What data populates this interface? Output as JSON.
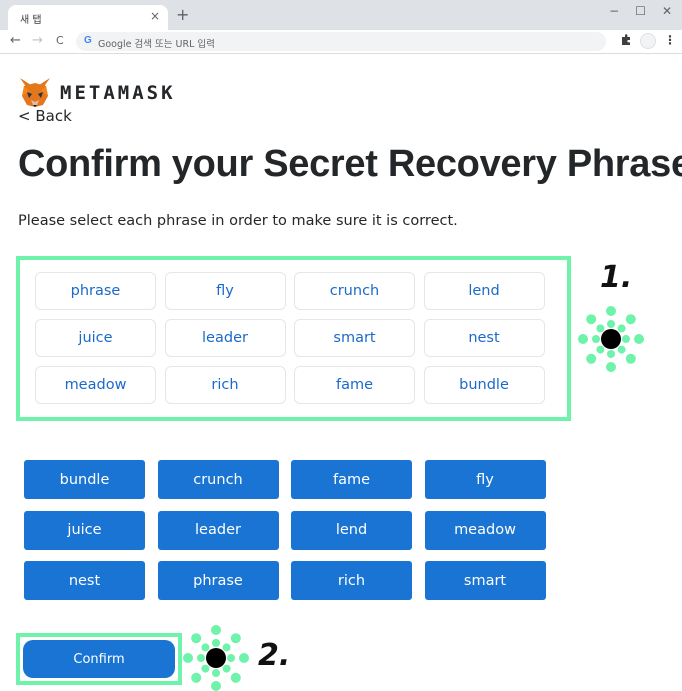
{
  "browser": {
    "tab_title": "새 탭",
    "tab_close": "×",
    "new_tab": "+",
    "window_minimize": "−",
    "window_maximize": "☐",
    "window_close": "✕",
    "nav_back": "←",
    "nav_forward": "→",
    "nav_reload": "C",
    "omnibox_g": "G",
    "omnibox_placeholder": "Google 검색 또는 URL 입력",
    "menu": "⋮"
  },
  "logo": {
    "text": "METAMASK"
  },
  "back_label": "< Back",
  "title": "Confirm your Secret Recovery Phrase",
  "instruction": "Please select each phrase in order to make sure it is correct.",
  "selected_words": [
    "phrase",
    "fly",
    "crunch",
    "lend",
    "juice",
    "leader",
    "smart",
    "nest",
    "meadow",
    "rich",
    "fame",
    "bundle"
  ],
  "available_words": [
    "bundle",
    "crunch",
    "fame",
    "fly",
    "juice",
    "leader",
    "lend",
    "meadow",
    "nest",
    "phrase",
    "rich",
    "smart"
  ],
  "confirm_label": "Confirm",
  "annotations": {
    "step1": "1.",
    "step2": "2.",
    "highlight_color": "#6ff2a9"
  },
  "colors": {
    "button_blue": "#1a74d4",
    "slot_text": "#1b6ac9"
  }
}
